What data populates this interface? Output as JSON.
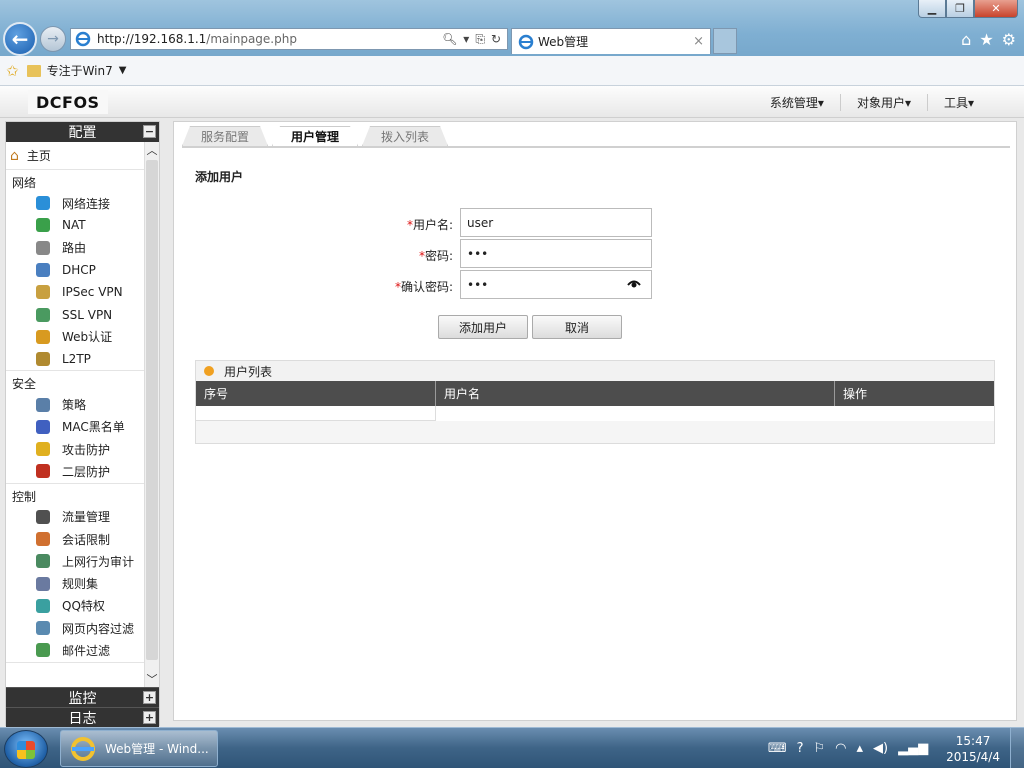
{
  "browser": {
    "url_host": "http://192.168.1.1",
    "url_path": "/mainpage.php",
    "tab_title": "Web管理",
    "tab_close": "×",
    "favorites_label": "专注于Win7",
    "window_controls": [
      "minimize",
      "restore",
      "close"
    ]
  },
  "app": {
    "logo": "DCFOS",
    "top_menu": [
      "系统管理▾",
      "对象用户▾",
      "工具▾"
    ]
  },
  "sidebar": {
    "header": "配置",
    "header_toggle": "−",
    "home": "主页",
    "groups": [
      {
        "title": "网络",
        "items": [
          {
            "label": "网络连接",
            "icon": "globe-icon",
            "color": "#2a8fd8"
          },
          {
            "label": "NAT",
            "icon": "nat-icon",
            "color": "#3aa04a"
          },
          {
            "label": "路由",
            "icon": "router-icon",
            "color": "#888888"
          },
          {
            "label": "DHCP",
            "icon": "dhcp-icon",
            "color": "#4a7fc0"
          },
          {
            "label": "IPSec VPN",
            "icon": "ipsec-icon",
            "color": "#c8a040"
          },
          {
            "label": "SSL VPN",
            "icon": "ssl-icon",
            "color": "#4a9a60"
          },
          {
            "label": "Web认证",
            "icon": "web-auth-icon",
            "color": "#d89a20"
          },
          {
            "label": "L2TP",
            "icon": "l2tp-icon",
            "color": "#b08a30"
          }
        ]
      },
      {
        "title": "安全",
        "items": [
          {
            "label": "策略",
            "icon": "policy-icon",
            "color": "#5a7fa8"
          },
          {
            "label": "MAC黑名单",
            "icon": "mac-blacklist-icon",
            "color": "#4060c0"
          },
          {
            "label": "攻击防护",
            "icon": "shield-icon",
            "color": "#e0b020"
          },
          {
            "label": "二层防护",
            "icon": "arp-icon",
            "color": "#c03020"
          }
        ]
      },
      {
        "title": "控制",
        "items": [
          {
            "label": "流量管理",
            "icon": "traffic-icon",
            "color": "#505050"
          },
          {
            "label": "会话限制",
            "icon": "session-icon",
            "color": "#d07030"
          },
          {
            "label": "上网行为审计",
            "icon": "audit-icon",
            "color": "#4a8a60"
          },
          {
            "label": "规则集",
            "icon": "ruleset-icon",
            "color": "#6a7aa0"
          },
          {
            "label": "QQ特权",
            "icon": "qq-icon",
            "color": "#3aa0a0"
          },
          {
            "label": "网页内容过滤",
            "icon": "filter-icon",
            "color": "#5a8ab0"
          },
          {
            "label": "邮件过滤",
            "icon": "mail-filter-icon",
            "color": "#4a9a50"
          }
        ]
      }
    ],
    "footer_sections": [
      {
        "label": "监控",
        "toggle": "+"
      },
      {
        "label": "日志",
        "toggle": "+"
      }
    ]
  },
  "main": {
    "tabs": [
      {
        "label": "服务配置",
        "active": false
      },
      {
        "label": "用户管理",
        "active": true
      },
      {
        "label": "拨入列表",
        "active": false
      }
    ],
    "form_title": "添加用户",
    "fields": {
      "username_label": "用户名:",
      "username_value": "user",
      "password_label": "密码:",
      "password_value": "•••",
      "confirm_label": "确认密码:",
      "confirm_value": "•••",
      "required_mark": "*"
    },
    "buttons": {
      "add": "添加用户",
      "cancel": "取消"
    },
    "user_list": {
      "title": "用户列表",
      "columns": [
        "序号",
        "用户名",
        "操作"
      ]
    }
  },
  "taskbar": {
    "task_label": "Web管理 - Wind...",
    "time": "15:47",
    "date": "2015/4/4"
  }
}
